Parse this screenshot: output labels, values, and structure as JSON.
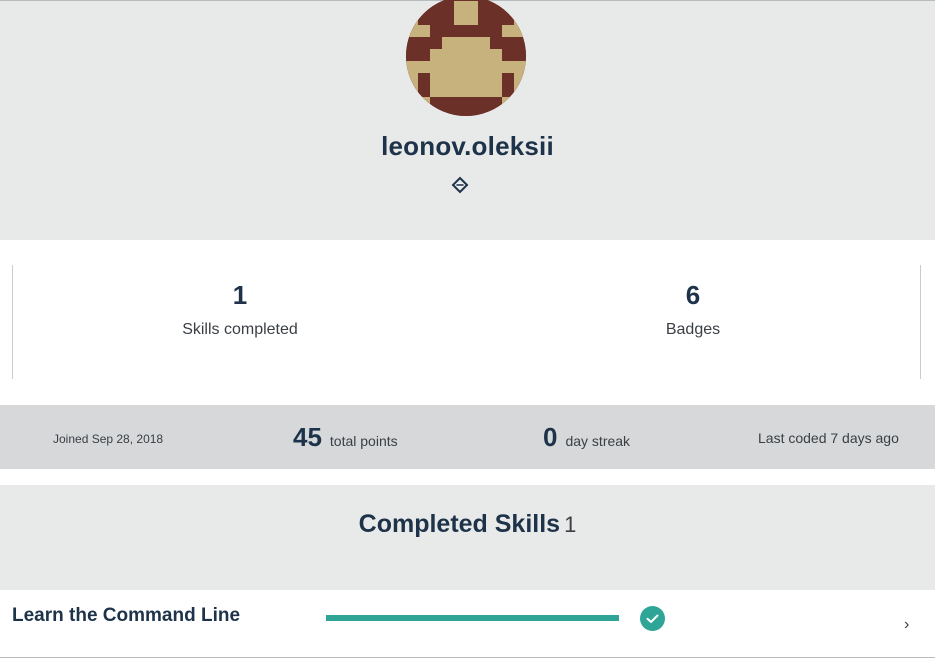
{
  "profile": {
    "username": "leonov.oleksii",
    "avatar_icon": "pixel-avatar-icon",
    "link_icon": "share-link-icon",
    "avatar_colors": {
      "dark": "#6b3028",
      "light": "#c7b17d"
    }
  },
  "stats": [
    {
      "value": "1",
      "label": "Skills completed"
    },
    {
      "value": "6",
      "label": "Badges"
    }
  ],
  "info_bar": {
    "joined": "Joined Sep 28, 2018",
    "points_value": "45",
    "points_label": "total points",
    "streak_value": "0",
    "streak_label": "day streak",
    "last_coded": "Last coded 7 days ago"
  },
  "completed": {
    "title": "Completed Skills",
    "count": "1"
  },
  "skills": [
    {
      "name": "Learn the Command Line",
      "progress": 1.0,
      "status_icon": "check-circle-icon",
      "chevron": "›"
    }
  ],
  "colors": {
    "accent": "#2fa598",
    "heading": "#1e3349",
    "section_bg": "#e8eaea",
    "info_bg": "#d6d8da"
  }
}
